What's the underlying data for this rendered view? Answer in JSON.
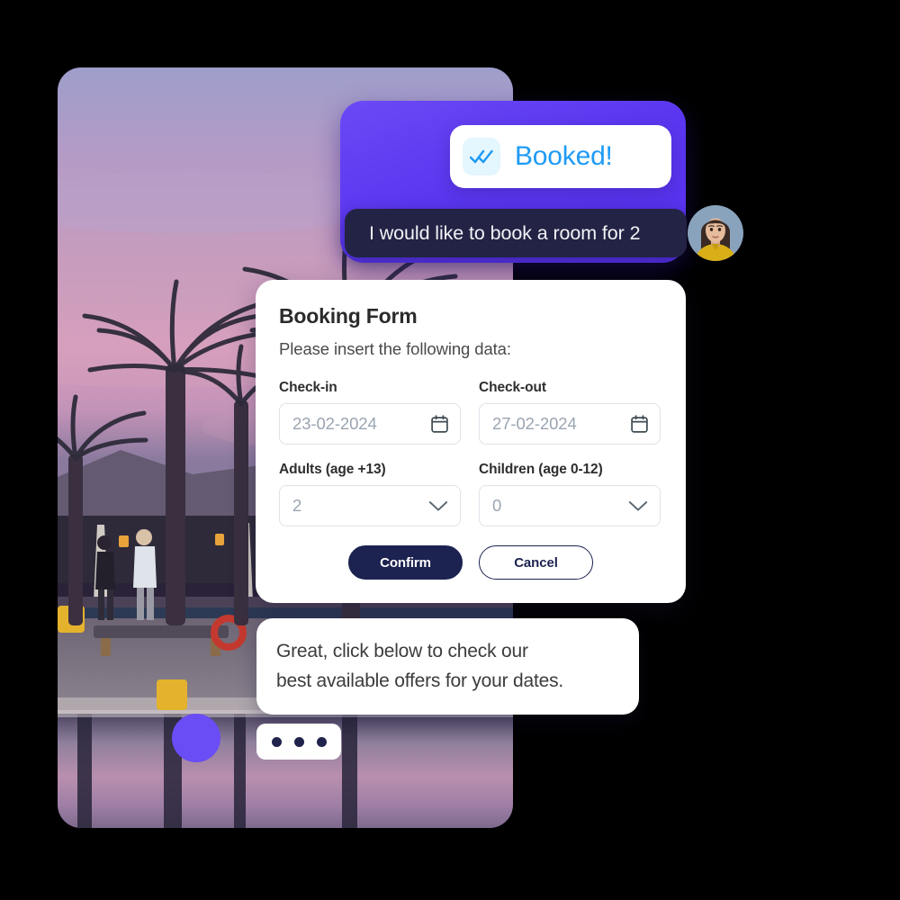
{
  "hero": {
    "alt": "resort-pool-at-sunset-with-palm-trees"
  },
  "booked_card": {
    "icon": "double-check-icon",
    "label": "Booked!",
    "accent_color": "#1e9bf5",
    "icon_bg_color": "#e4f6fe"
  },
  "purple_panel": {
    "color_from": "#6b49f5",
    "color_to": "#5730ee"
  },
  "user_message": {
    "text": "I would like to book a room for 2",
    "bubble_color": "#232345",
    "text_color": "#f2f2f6"
  },
  "avatar": {
    "name": "user-avatar",
    "alt": "portrait-of-woman-in-yellow-top"
  },
  "booking_form": {
    "title": "Booking Form",
    "subtitle": "Please insert the following data:",
    "fields": [
      {
        "label": "Check-in",
        "value": "23-02-2024",
        "icon": "calendar-icon",
        "type": "date"
      },
      {
        "label": "Check-out",
        "value": "27-02-2024",
        "icon": "calendar-icon",
        "type": "date"
      },
      {
        "label": "Adults (age +13)",
        "value": "2",
        "icon": "chevron-down-icon",
        "type": "select"
      },
      {
        "label": "Children (age 0-12)",
        "value": "0",
        "icon": "chevron-down-icon",
        "type": "select"
      }
    ],
    "confirm_label": "Confirm",
    "cancel_label": "Cancel",
    "primary_color": "#1d2350"
  },
  "bot_message": {
    "line1": "Great, click below to check our",
    "line2": "best available offers for your dates."
  },
  "bot_avatar": {
    "color": "#6b4df6"
  },
  "typing_indicator": {
    "dots": 3,
    "dot_color": "#20234b"
  }
}
